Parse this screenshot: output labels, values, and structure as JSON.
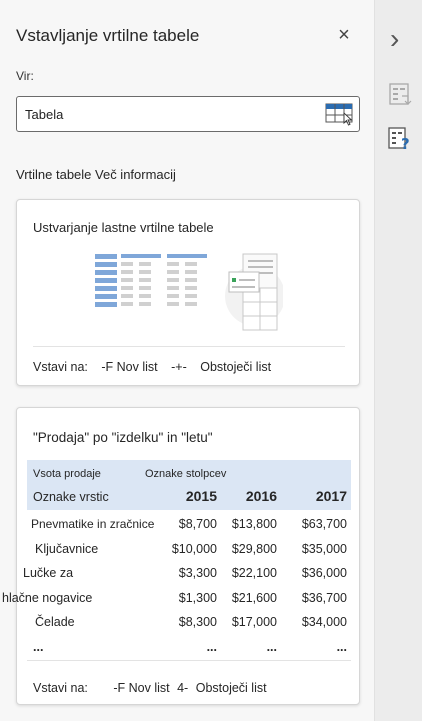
{
  "pane": {
    "title": "Vstavljanje vrtilne tabele",
    "close_label": "×",
    "source_label": "Vir:",
    "source_value": "Tabela",
    "section_heading": "Vrtilne tabele Več informacij"
  },
  "card_own": {
    "title": "Ustvarjanje lastne vrtilne tabele",
    "insert_label": "Vstavi na:",
    "insert_new": "-F Nov list",
    "insert_sep": "-+-",
    "insert_existing": "Obstoječi list"
  },
  "card_suggest": {
    "title": "\"Prodaja\" po \"izdelku\" in \"letu\"",
    "head_sum": "Vsota prodaje",
    "head_cols": "Oznake stolpcev",
    "head_rows": "Oznake vrstic",
    "years": [
      "2015",
      "2016",
      "2017"
    ],
    "rows": [
      {
        "label": "Pnevmatike in zračnice",
        "v": [
          "$8,700",
          "$13,800",
          "$63,700"
        ]
      },
      {
        "label": "Ključavnice",
        "v": [
          "$10,000",
          "$29,800",
          "$35,000"
        ]
      },
      {
        "label": "Lučke za",
        "v": [
          "$3,300",
          "$22,100",
          "$36,000"
        ]
      },
      {
        "label": "hlačne nogavice",
        "v": [
          "$1,300",
          "$21,600",
          "$36,700"
        ]
      },
      {
        "label": "Čelade",
        "v": [
          "$8,300",
          "$17,000",
          "$34,000"
        ]
      },
      {
        "label": "...",
        "v": [
          "...",
          "...",
          "..."
        ]
      }
    ],
    "insert_label": "Vstavi na:",
    "insert_new": "-F Nov list",
    "insert_sep": "4-",
    "insert_existing": "Obstoječi list"
  },
  "rail": {
    "expand_glyph": "›"
  },
  "colors": {
    "accent": "#2b6cb0",
    "pivot_header_bg": "#dbe6f4"
  }
}
